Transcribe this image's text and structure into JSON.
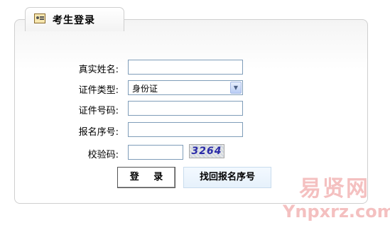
{
  "tab": {
    "title": "考生登录",
    "icon": "id-card-icon"
  },
  "form": {
    "name_label": "真实姓名:",
    "name_value": "",
    "id_type_label": "证件类型:",
    "id_type_selected": "身份证",
    "id_number_label": "证件号码:",
    "id_number_value": "",
    "reg_number_label": "报名序号:",
    "reg_number_value": "",
    "captcha_label": "校验码:",
    "captcha_value": "",
    "captcha_text": "3264"
  },
  "buttons": {
    "login": "登 录",
    "find_reg": "找回报名序号"
  },
  "watermark": {
    "cn": "易贤网",
    "en": "Ynpxrz.com"
  },
  "colors": {
    "border": "#cfcfcf",
    "field_border": "#7f9db9",
    "watermark": "#eb8c8c"
  }
}
